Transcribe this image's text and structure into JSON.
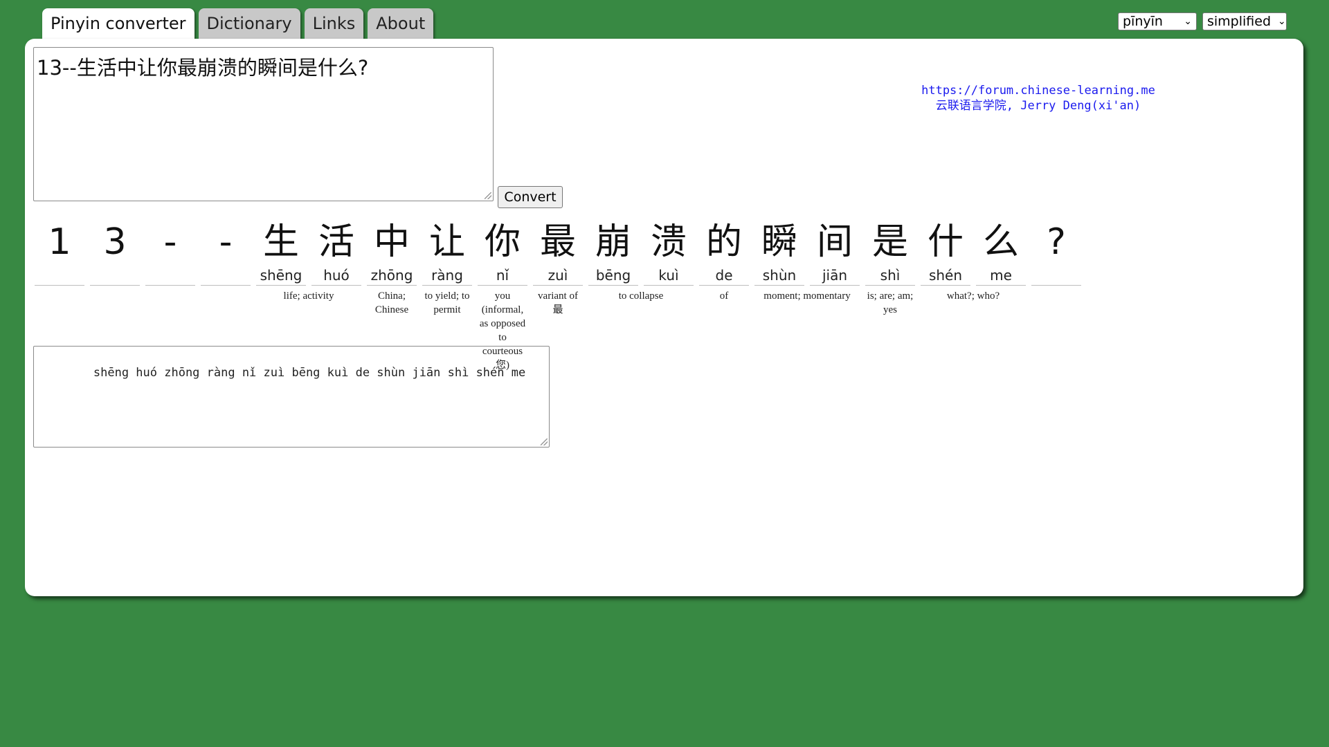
{
  "tabs": [
    {
      "label": "Pinyin converter",
      "active": true
    },
    {
      "label": "Dictionary",
      "active": false
    },
    {
      "label": "Links",
      "active": false
    },
    {
      "label": "About",
      "active": false
    }
  ],
  "selects": {
    "romanization": "pīnyīn",
    "script": "simplified"
  },
  "input": {
    "value": "13--生活中让你最崩溃的瞬间是什么?"
  },
  "convert_label": "Convert",
  "credits": {
    "url": "https://forum.chinese-learning.me",
    "line2": "云联语言学院, Jerry Deng(xi'an)"
  },
  "characters": [
    {
      "hz": "1",
      "py": ""
    },
    {
      "hz": "3",
      "py": ""
    },
    {
      "hz": "-",
      "py": ""
    },
    {
      "hz": "-",
      "py": ""
    },
    {
      "hz": "生",
      "py": "shēng"
    },
    {
      "hz": "活",
      "py": "huó"
    },
    {
      "hz": "中",
      "py": "zhōng"
    },
    {
      "hz": "让",
      "py": "ràng"
    },
    {
      "hz": "你",
      "py": "nǐ"
    },
    {
      "hz": "最",
      "py": "zuì"
    },
    {
      "hz": "崩",
      "py": "bēng"
    },
    {
      "hz": "溃",
      "py": "kuì"
    },
    {
      "hz": "的",
      "py": "de"
    },
    {
      "hz": "瞬",
      "py": "shùn"
    },
    {
      "hz": "间",
      "py": "jiān"
    },
    {
      "hz": "是",
      "py": "shì"
    },
    {
      "hz": "什",
      "py": "shén"
    },
    {
      "hz": "么",
      "py": "me"
    },
    {
      "hz": "?",
      "py": ""
    }
  ],
  "definitions": [
    {
      "text": "life; activity"
    },
    {
      "text": "China; Chinese"
    },
    {
      "text": "to yield; to permit"
    },
    {
      "text": "you (informal, as opposed to courteous 您)"
    },
    {
      "text": "variant of 最"
    },
    {
      "text": "to collapse"
    },
    {
      "text": "of"
    },
    {
      "text": "moment; momentary"
    },
    {
      "text": "is; are; am; yes"
    },
    {
      "text": "what?; who?"
    }
  ],
  "output": {
    "value": "    shēng huó zhōng ràng nǐ zuì bēng kuì de shùn jiān shì shén me"
  }
}
